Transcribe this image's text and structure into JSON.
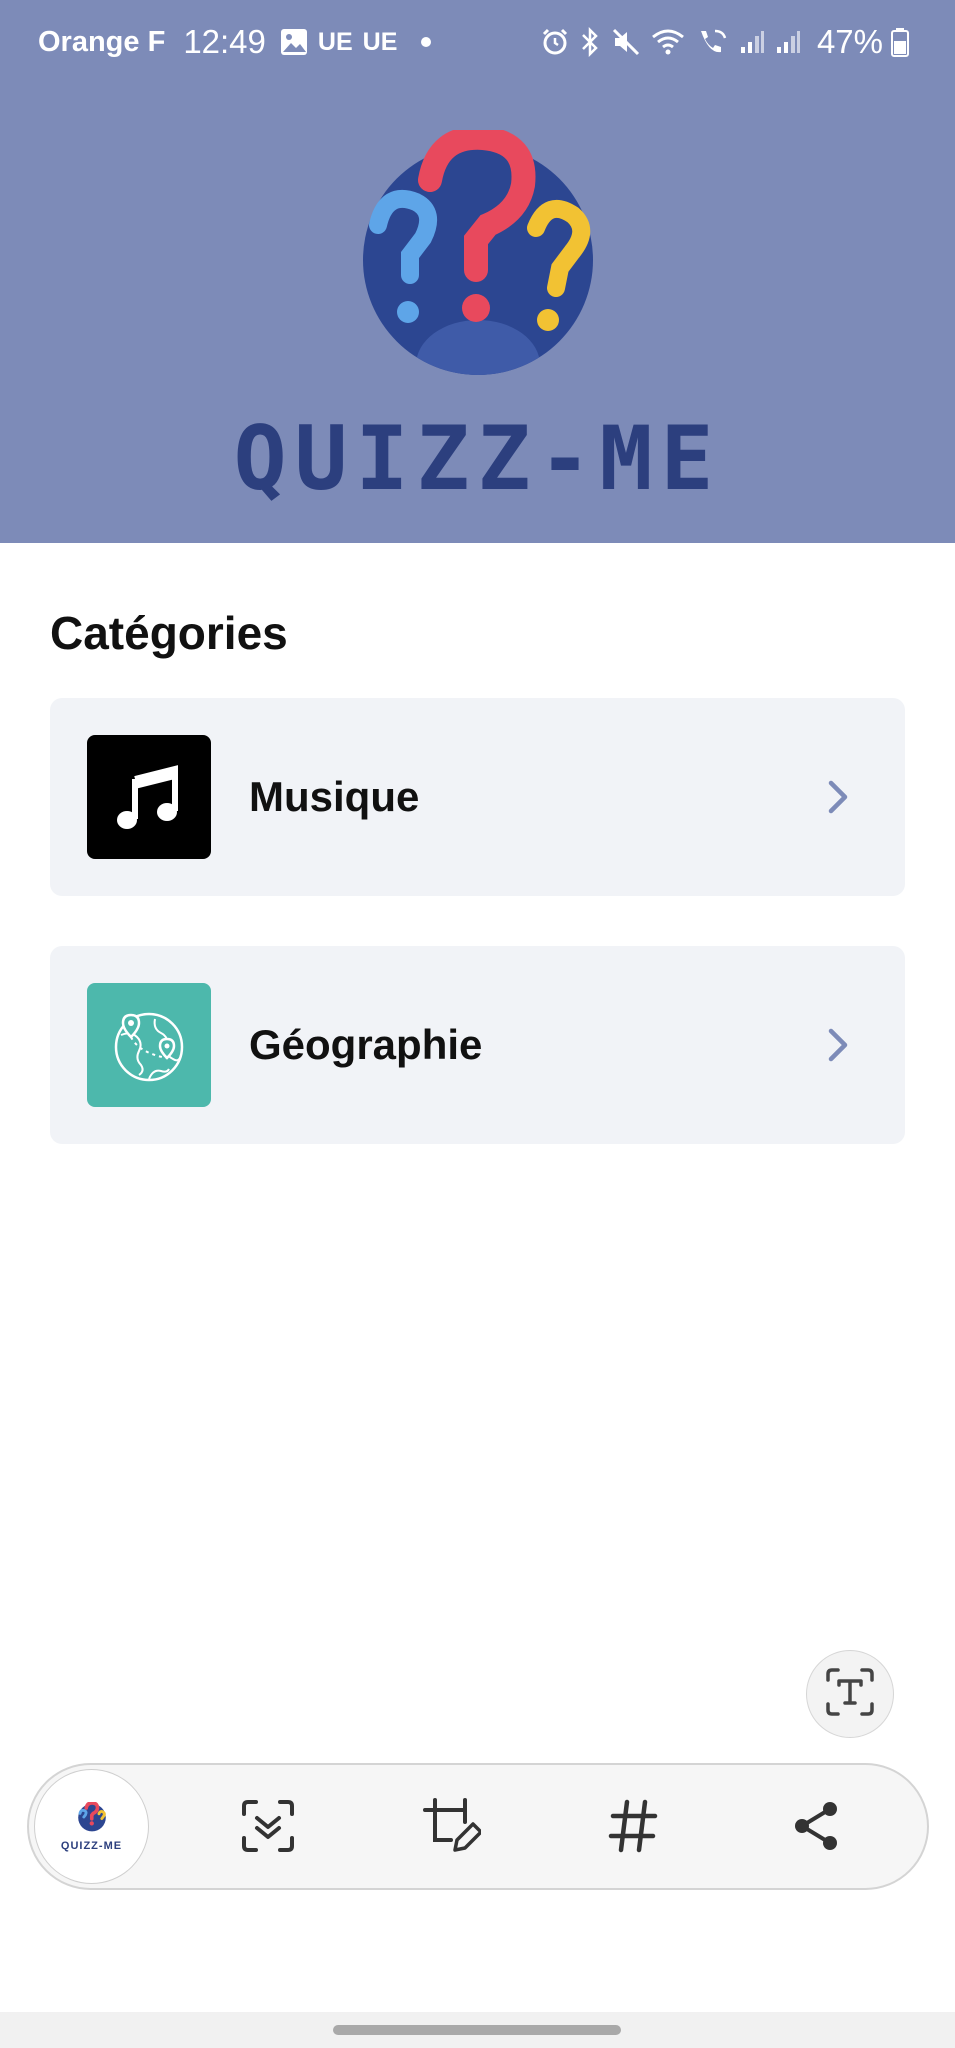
{
  "status_bar": {
    "carrier": "Orange F",
    "time": "12:49",
    "network_labels": [
      "UE",
      "UE"
    ],
    "battery_percent": "47%",
    "icons": [
      "image-icon",
      "alarm-icon",
      "bluetooth-icon",
      "mute-icon",
      "wifi-icon",
      "wifi-call-icon",
      "signal-icon",
      "signal-icon",
      "battery-icon"
    ]
  },
  "header": {
    "logo_text": "QUIZZ-ME",
    "background_color": "#7d8bb8",
    "logo_text_color": "#2c3f7e"
  },
  "main": {
    "section_title": "Catégories",
    "categories": [
      {
        "label": "Musique",
        "icon": "music-note-icon",
        "icon_bg": "#000000"
      },
      {
        "label": "Géographie",
        "icon": "globe-icon",
        "icon_bg": "#4db8ac"
      }
    ],
    "chevron_color": "#7d8bb8"
  },
  "toolbar": {
    "thumb_label": "QUIZZ-ME",
    "buttons": [
      "scroll-capture-icon",
      "crop-edit-icon",
      "hashtag-icon",
      "share-icon"
    ],
    "text_extract_icon": "text-extract-icon"
  }
}
